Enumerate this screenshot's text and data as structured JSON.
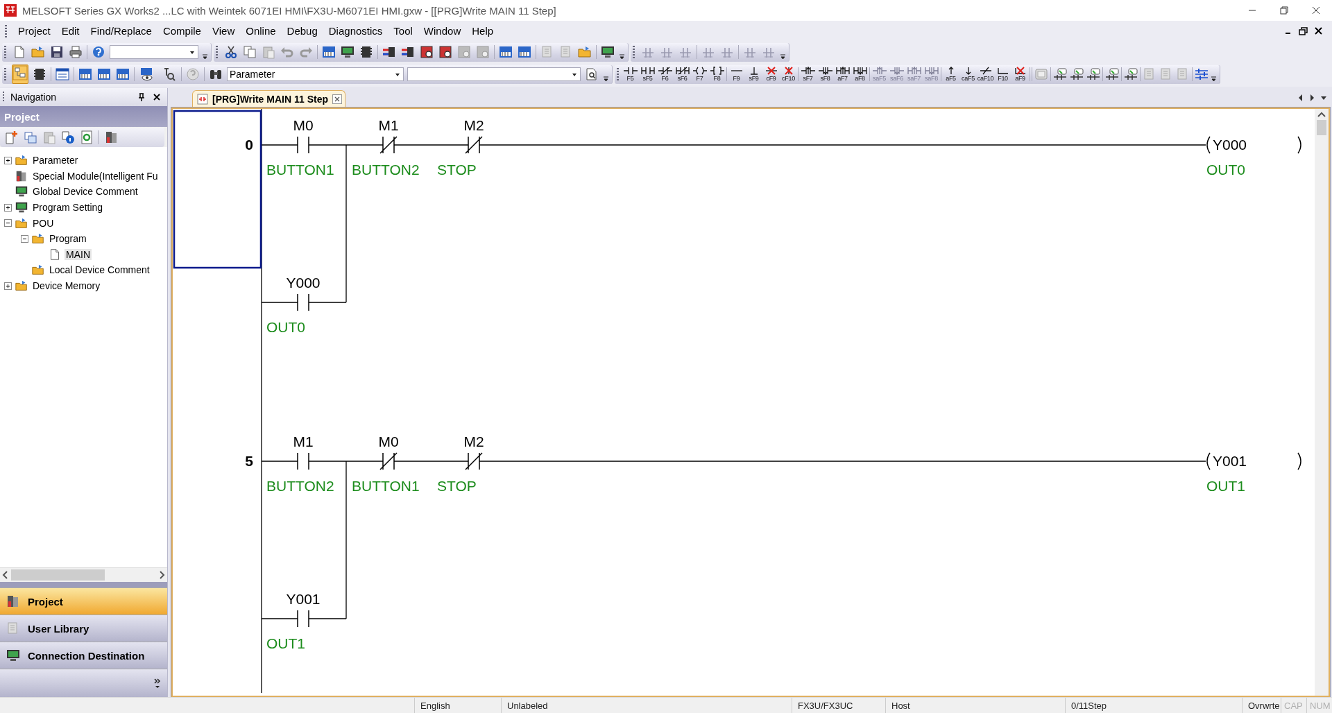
{
  "window": {
    "title": "MELSOFT Series GX Works2 ...LC with Weintek 6071EI HMI\\FX3U-M6071EI HMI.gxw - [[PRG]Write MAIN 11 Step]"
  },
  "menu": [
    "Project",
    "Edit",
    "Find/Replace",
    "Compile",
    "View",
    "Online",
    "Debug",
    "Diagnostics",
    "Tool",
    "Window",
    "Help"
  ],
  "toolbar": {
    "element_dropdown": "Parameter",
    "ladder_keys": [
      {
        "key": "F5",
        "kind": "contact",
        "disabled": false
      },
      {
        "key": "sF5",
        "kind": "contact_par",
        "disabled": false
      },
      {
        "key": "F6",
        "kind": "contact_nc",
        "disabled": false
      },
      {
        "key": "sF6",
        "kind": "contact_nc_par",
        "disabled": false
      },
      {
        "key": "F7",
        "kind": "coil",
        "disabled": false
      },
      {
        "key": "F8",
        "kind": "func",
        "disabled": false
      },
      {
        "key": "F9",
        "kind": "hline",
        "disabled": false
      },
      {
        "key": "sF9",
        "kind": "vline",
        "disabled": false
      },
      {
        "key": "cF9",
        "kind": "del_hline",
        "disabled": false
      },
      {
        "key": "cF10",
        "kind": "del_vline",
        "disabled": false
      },
      {
        "key": "sF7",
        "kind": "pulse_up",
        "disabled": false
      },
      {
        "key": "sF8",
        "kind": "pulse_down",
        "disabled": false
      },
      {
        "key": "aF7",
        "kind": "pulse_up_par",
        "disabled": false
      },
      {
        "key": "aF8",
        "kind": "pulse_down_par",
        "disabled": false
      },
      {
        "key": "saF5",
        "kind": "pulse_up",
        "disabled": true
      },
      {
        "key": "saF6",
        "kind": "pulse_down",
        "disabled": true
      },
      {
        "key": "saF7",
        "kind": "pulse_up_par",
        "disabled": true
      },
      {
        "key": "saF8",
        "kind": "pulse_down_par",
        "disabled": true
      },
      {
        "key": "aF5",
        "kind": "arrow_up",
        "disabled": false
      },
      {
        "key": "caF5",
        "kind": "arrow_down",
        "disabled": false
      },
      {
        "key": "caF10",
        "kind": "invert",
        "disabled": false
      },
      {
        "key": "F10",
        "kind": "draw",
        "disabled": false
      },
      {
        "key": "aF9",
        "kind": "erase",
        "disabled": false
      }
    ]
  },
  "navigation": {
    "title": "Navigation",
    "section": "Project",
    "tree": [
      {
        "label": "Parameter",
        "expanded": false,
        "selected": false
      },
      {
        "label": "Special Module(Intelligent Fu",
        "selected": false
      },
      {
        "label": "Global Device Comment",
        "selected": false
      },
      {
        "label": "Program Setting",
        "expanded": false,
        "selected": false
      },
      {
        "label": "POU",
        "expanded": true,
        "selected": false,
        "children": [
          {
            "label": "Program",
            "expanded": true,
            "selected": false,
            "children": [
              {
                "label": "MAIN",
                "selected": true
              }
            ]
          },
          {
            "label": "Local Device Comment",
            "selected": false
          }
        ]
      },
      {
        "label": "Device Memory",
        "expanded": false,
        "selected": false
      }
    ],
    "buttons": [
      {
        "label": "Project",
        "selected": true
      },
      {
        "label": "User Library",
        "selected": false
      },
      {
        "label": "Connection Destination",
        "selected": false
      }
    ]
  },
  "editor": {
    "tabs": [
      {
        "label": "[PRG]Write MAIN 11 Step",
        "selected": true
      }
    ],
    "rungs": [
      {
        "step": "0",
        "selected": true,
        "contacts": [
          {
            "device": "M0",
            "comment": "BUTTON1",
            "kind": "no"
          },
          {
            "device": "M1",
            "comment": "BUTTON2",
            "kind": "nc"
          },
          {
            "device": "M2",
            "comment": "STOP",
            "kind": "nc"
          }
        ],
        "branch": {
          "device": "Y000",
          "comment": "OUT0",
          "kind": "no"
        },
        "coil": {
          "device": "Y000",
          "comment": "OUT0"
        }
      },
      {
        "step": "5",
        "selected": false,
        "contacts": [
          {
            "device": "M1",
            "comment": "BUTTON2",
            "kind": "no"
          },
          {
            "device": "M0",
            "comment": "BUTTON1",
            "kind": "nc"
          },
          {
            "device": "M2",
            "comment": "STOP",
            "kind": "nc"
          }
        ],
        "branch": {
          "device": "Y001",
          "comment": "OUT1",
          "kind": "no"
        },
        "coil": {
          "device": "Y001",
          "comment": "OUT1"
        }
      }
    ]
  },
  "status_bar": [
    {
      "text": "English",
      "disabled": false
    },
    {
      "text": "Unlabeled",
      "disabled": false
    },
    {
      "text": "FX3U/FX3UC",
      "disabled": false
    },
    {
      "text": "Host",
      "disabled": false
    },
    {
      "text": "0/11Step",
      "disabled": false
    },
    {
      "text": "Ovrwrte",
      "disabled": false
    },
    {
      "text": "CAP",
      "disabled": true
    },
    {
      "text": "NUM",
      "disabled": true
    }
  ]
}
